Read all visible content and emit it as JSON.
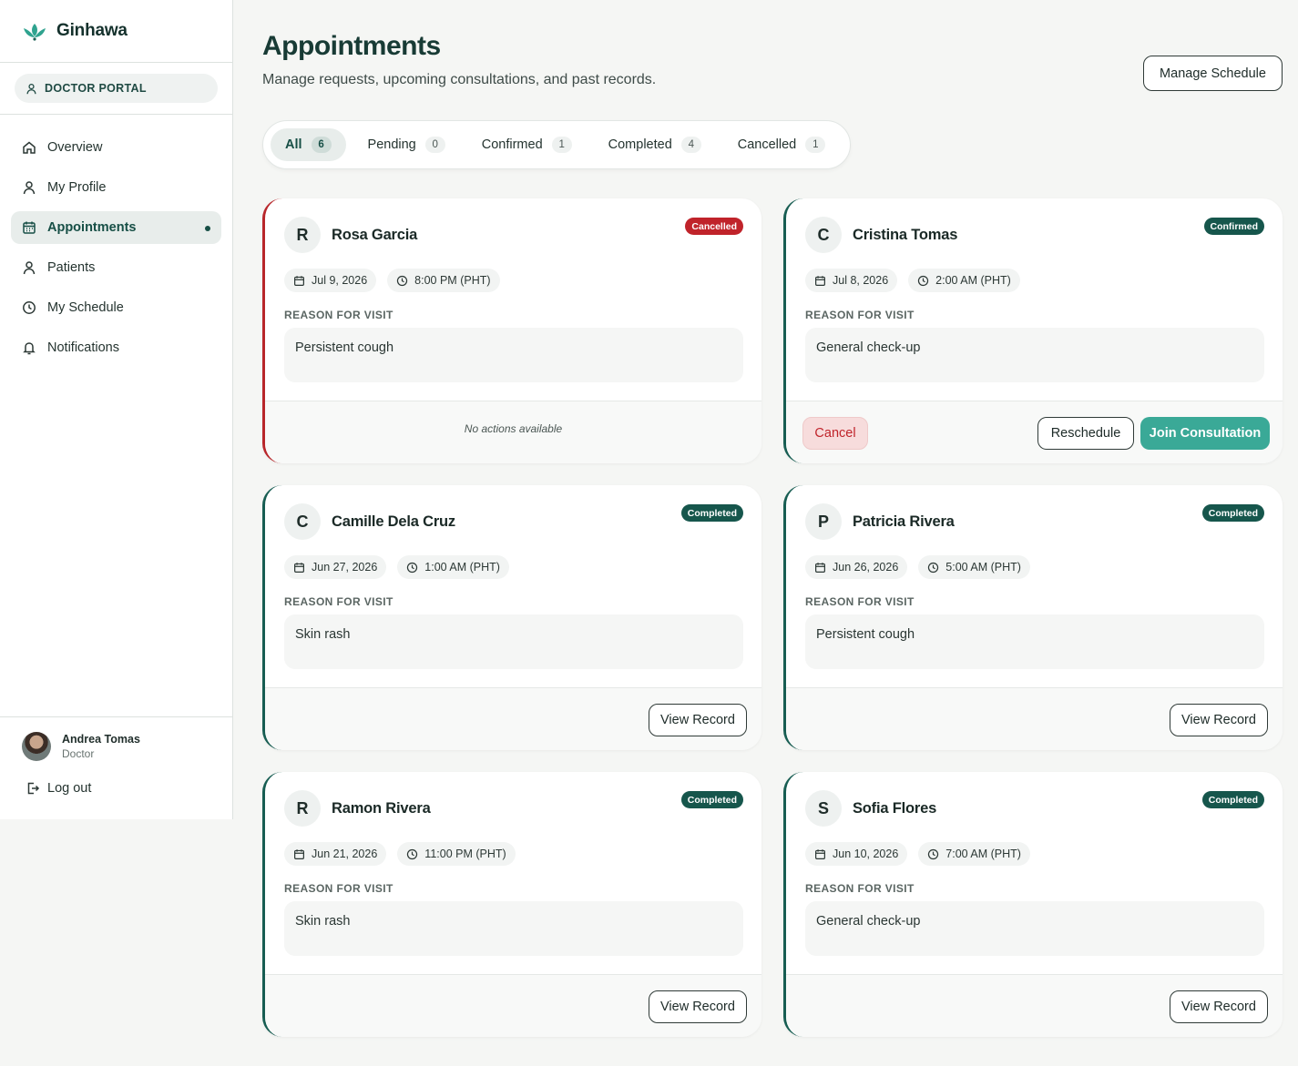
{
  "brand": {
    "name": "Ginhawa"
  },
  "portal": {
    "label": "DOCTOR PORTAL"
  },
  "nav": [
    {
      "label": "Overview",
      "icon": "home-icon",
      "active": false
    },
    {
      "label": "My Profile",
      "icon": "user-icon",
      "active": false
    },
    {
      "label": "Appointments",
      "icon": "calendar-icon",
      "active": true
    },
    {
      "label": "Patients",
      "icon": "user-icon",
      "active": false
    },
    {
      "label": "My Schedule",
      "icon": "clock-icon",
      "active": false
    },
    {
      "label": "Notifications",
      "icon": "bell-icon",
      "active": false
    }
  ],
  "user": {
    "name": "Andrea Tomas",
    "role": "Doctor",
    "logout": "Log out"
  },
  "header": {
    "title": "Appointments",
    "subtitle": "Manage requests, upcoming consultations, and past records.",
    "manage_button": "Manage Schedule"
  },
  "tabs": [
    {
      "label": "All",
      "count": "6",
      "active": true
    },
    {
      "label": "Pending",
      "count": "0",
      "active": false
    },
    {
      "label": "Confirmed",
      "count": "1",
      "active": false
    },
    {
      "label": "Completed",
      "count": "4",
      "active": false
    },
    {
      "label": "Cancelled",
      "count": "1",
      "active": false
    }
  ],
  "reason_label": "REASON FOR VISIT",
  "colors": {
    "primary": "#16564c",
    "accent": "#3aa997",
    "danger": "#c0232a"
  },
  "appointments": [
    {
      "initial": "R",
      "name": "Rosa Garcia",
      "status": "Cancelled",
      "date": "Jul 9, 2026",
      "time": "8:00 PM (PHT)",
      "reason": "Persistent cough",
      "footer_note": "No actions available"
    },
    {
      "initial": "C",
      "name": "Cristina Tomas",
      "status": "Confirmed",
      "date": "Jul 8, 2026",
      "time": "2:00 AM (PHT)",
      "reason": "General check-up",
      "actions": {
        "cancel": "Cancel",
        "reschedule": "Reschedule",
        "join": "Join Consultation"
      }
    },
    {
      "initial": "C",
      "name": "Camille Dela Cruz",
      "status": "Completed",
      "date": "Jun 27, 2026",
      "time": "1:00 AM (PHT)",
      "reason": "Skin rash",
      "action": "View Record"
    },
    {
      "initial": "P",
      "name": "Patricia Rivera",
      "status": "Completed",
      "date": "Jun 26, 2026",
      "time": "5:00 AM (PHT)",
      "reason": "Persistent cough",
      "action": "View Record"
    },
    {
      "initial": "R",
      "name": "Ramon Rivera",
      "status": "Completed",
      "date": "Jun 21, 2026",
      "time": "11:00 PM (PHT)",
      "reason": "Skin rash",
      "action": "View Record"
    },
    {
      "initial": "S",
      "name": "Sofia Flores",
      "status": "Completed",
      "date": "Jun 10, 2026",
      "time": "7:00 AM (PHT)",
      "reason": "General check-up",
      "action": "View Record"
    }
  ]
}
